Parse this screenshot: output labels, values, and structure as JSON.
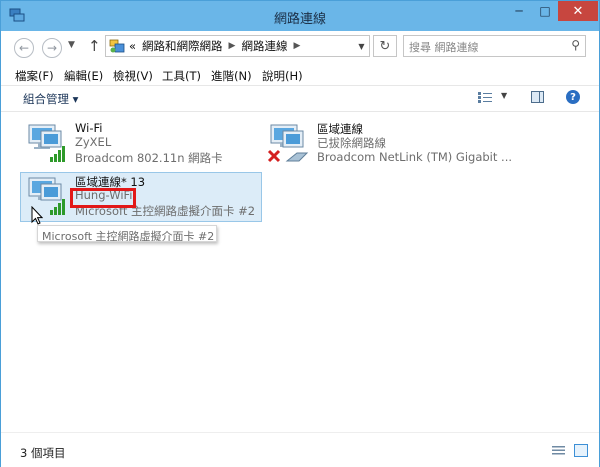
{
  "window": {
    "title": "網路連線"
  },
  "window_controls": {
    "minimize": "─",
    "maximize": "□",
    "close": "✕"
  },
  "address_bar": {
    "back": "←",
    "forward": "→",
    "recent": "▼",
    "up": "↑",
    "prefix": "«",
    "crumbs": [
      "網路和網際網路",
      "網路連線"
    ],
    "crumb_sep": "▶",
    "dropdown": "▼",
    "refresh": "↻",
    "search_placeholder": "搜尋 網路連線",
    "search_icon": "⚲"
  },
  "menu": [
    "檔案(F)",
    "編輯(E)",
    "檢視(V)",
    "工具(T)",
    "進階(N)",
    "說明(H)"
  ],
  "toolbar": {
    "organize_label": "組合管理 ▾",
    "view_dropdown": "▼",
    "help": "?"
  },
  "connections": [
    {
      "name": "Wi-Fi",
      "status": "ZyXEL",
      "device": "Broadcom 802.11n 網路卡",
      "icon": "wifi-connected-icon",
      "state": "connected"
    },
    {
      "name": "區域連線",
      "status": "已拔除網路線",
      "device": "Broadcom NetLink (TM) Gigabit ...",
      "icon": "ethernet-disconnected-icon",
      "state": "disconnected"
    },
    {
      "name": "區域連線* 13",
      "status": "Hung-WiFi",
      "device": "Microsoft 主控網路虛擬介面卡 #2",
      "icon": "virtual-adapter-icon",
      "state": "connected",
      "selected": true
    }
  ],
  "tooltip": "Microsoft 主控網路虛擬介面卡 #2",
  "statusbar": {
    "item_count": "3 個項目"
  },
  "colors": {
    "title_bar": "#6ab6e8",
    "close_button": "#c7463f",
    "selection": "#dcecf8",
    "highlight_box": "#e21818",
    "signal_green": "#2e9a2a",
    "disconnect_red": "#d42020"
  }
}
